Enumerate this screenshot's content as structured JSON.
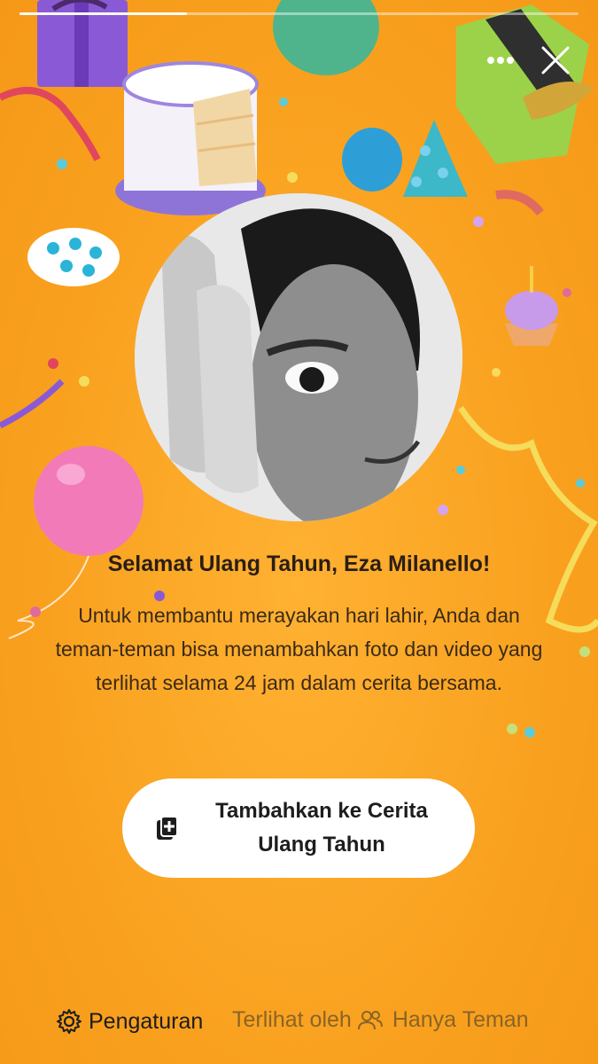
{
  "story": {
    "progress": 0.3
  },
  "top_actions": {
    "more_icon": "more-horizontal-icon",
    "close_icon": "close-icon"
  },
  "greeting": {
    "title": "Selamat Ulang Tahun, Eza Milanello!",
    "description": "Untuk membantu merayakan hari lahir, Anda dan teman-teman bisa menambahkan foto dan video yang terlihat selama 24 jam dalam cerita bersama."
  },
  "cta": {
    "label": "Tambahkan ke Cerita Ulang Tahun",
    "icon": "add-story-icon"
  },
  "footer": {
    "settings_label": "Pengaturan",
    "settings_icon": "gear-icon",
    "viewed_by_label": "Terlihat oleh",
    "audience_icon": "friends-icon",
    "audience_label": "Hanya Teman"
  },
  "colors": {
    "background": "#f8a020",
    "button": "#ffffff",
    "title_text": "#2a1e14"
  }
}
